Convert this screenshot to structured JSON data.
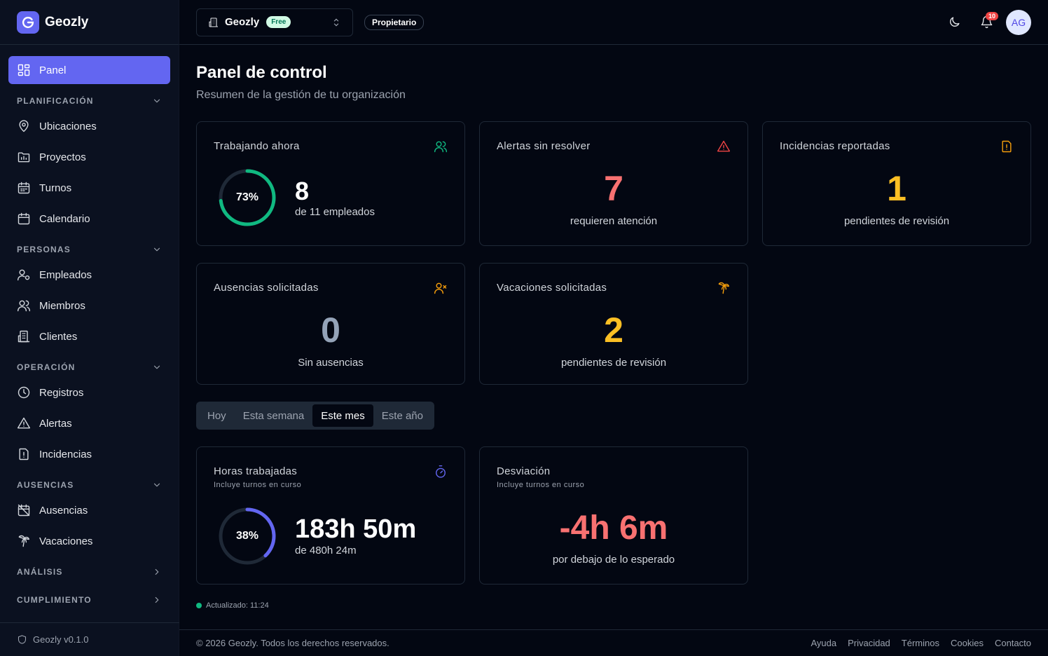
{
  "app": {
    "name": "Geozly",
    "version": "Geozly v0.1.0"
  },
  "header": {
    "org_name": "Geozly",
    "plan": "Free",
    "role": "Propietario",
    "notifications_count": "10",
    "avatar_initials": "AG"
  },
  "sidebar": {
    "panel": "Panel",
    "sections": {
      "planificacion": "PLANIFICACIÓN",
      "personas": "PERSONAS",
      "operacion": "OPERACIÓN",
      "ausencias": "AUSENCIAS",
      "analisis": "ANÁLISIS",
      "cumplimiento": "CUMPLIMIENTO"
    },
    "items": {
      "ubicaciones": "Ubicaciones",
      "proyectos": "Proyectos",
      "turnos": "Turnos",
      "calendario": "Calendario",
      "empleados": "Empleados",
      "miembros": "Miembros",
      "clientes": "Clientes",
      "registros": "Registros",
      "alertas": "Alertas",
      "incidencias": "Incidencias",
      "ausencias": "Ausencias",
      "vacaciones": "Vacaciones"
    }
  },
  "page": {
    "title": "Panel de control",
    "subtitle": "Resumen de la gestión de tu organización"
  },
  "cards": {
    "working": {
      "title": "Trabajando ahora",
      "percent": 0.73,
      "percent_label": "73%",
      "value": "8",
      "detail": "de 11 empleados"
    },
    "alerts": {
      "title": "Alertas sin resolver",
      "value": "7",
      "caption": "requieren atención"
    },
    "incidents": {
      "title": "Incidencias reportadas",
      "value": "1",
      "caption": "pendientes de revisión"
    },
    "absences": {
      "title": "Ausencias solicitadas",
      "value": "0",
      "caption": "Sin ausencias"
    },
    "vacations": {
      "title": "Vacaciones solicitadas",
      "value": "2",
      "caption": "pendientes de revisión"
    },
    "hours": {
      "title": "Horas trabajadas",
      "subtitle": "Incluye turnos en curso",
      "percent": 0.38,
      "percent_label": "38%",
      "value": "183h 50m",
      "detail": "de 480h 24m"
    },
    "deviation": {
      "title": "Desviación",
      "subtitle": "Incluye turnos en curso",
      "value": "-4h 6m",
      "caption": "por debajo de lo esperado"
    }
  },
  "period_tabs": [
    "Hoy",
    "Esta semana",
    "Este mes",
    "Este año"
  ],
  "active_tab": "Este mes",
  "updated": "Actualizado: 11:24",
  "footer": {
    "copyright": "© 2026 Geozly. Todos los derechos reservados.",
    "links": [
      "Ayuda",
      "Privacidad",
      "Términos",
      "Cookies",
      "Contacto"
    ]
  },
  "colors": {
    "accent": "#6366f1",
    "success": "#10b981",
    "danger": "#f87171",
    "warning": "#fbbf24",
    "muted_value": "#94a3b8"
  }
}
